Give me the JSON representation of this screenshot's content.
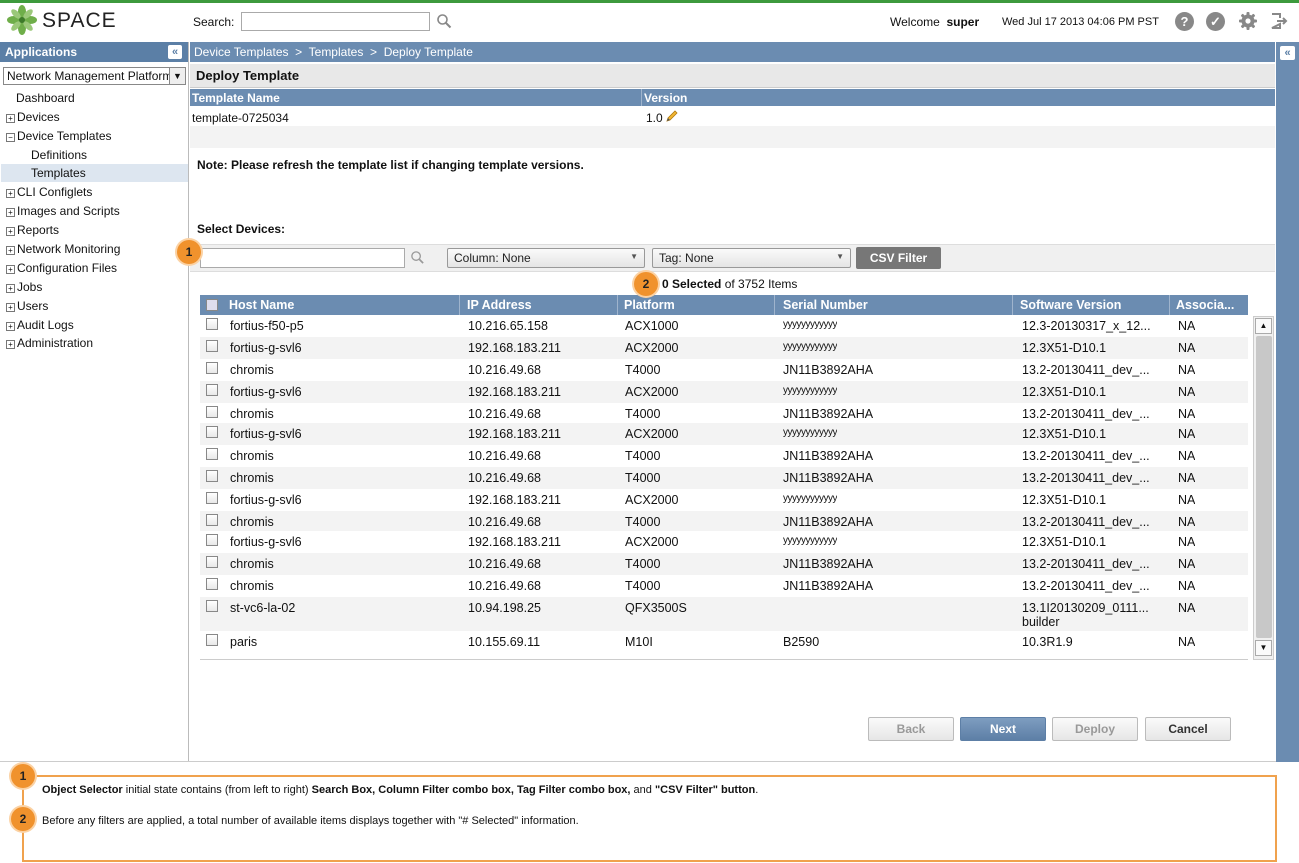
{
  "app": {
    "logo_text": "SPACE"
  },
  "header": {
    "search_label": "Search:",
    "search_value": "",
    "welcome_prefix": "Welcome",
    "username": "super",
    "datetime": "Wed Jul 17 2013 04:06 PM PST",
    "icons": [
      "help-icon",
      "tasks-icon",
      "settings-icon",
      "logout-icon"
    ]
  },
  "sidebar": {
    "title": "Applications",
    "app_selected": "Network Management Platform",
    "items": [
      {
        "label": "Dashboard",
        "expandable": false,
        "indent": 0
      },
      {
        "label": "Devices",
        "expandable": true,
        "expanded": false,
        "indent": 0
      },
      {
        "label": "Device Templates",
        "expandable": true,
        "expanded": true,
        "indent": 0
      },
      {
        "label": "Definitions",
        "expandable": false,
        "indent": 1
      },
      {
        "label": "Templates",
        "expandable": false,
        "indent": 1,
        "selected": true
      },
      {
        "label": "CLI Configlets",
        "expandable": true,
        "expanded": false,
        "indent": 0
      },
      {
        "label": "Images and Scripts",
        "expandable": true,
        "expanded": false,
        "indent": 0
      },
      {
        "label": "Reports",
        "expandable": true,
        "expanded": false,
        "indent": 0
      },
      {
        "label": "Network Monitoring",
        "expandable": true,
        "expanded": false,
        "indent": 0
      },
      {
        "label": "Configuration Files",
        "expandable": true,
        "expanded": false,
        "indent": 0
      },
      {
        "label": "Jobs",
        "expandable": true,
        "expanded": false,
        "indent": 0
      },
      {
        "label": "Users",
        "expandable": true,
        "expanded": false,
        "indent": 0
      },
      {
        "label": "Audit Logs",
        "expandable": true,
        "expanded": false,
        "indent": 0
      },
      {
        "label": "Administration",
        "expandable": true,
        "expanded": false,
        "indent": 0
      }
    ]
  },
  "breadcrumb": [
    "Device Templates",
    "Templates",
    "Deploy Template"
  ],
  "breadcrumb_sep": ">",
  "page_title": "Deploy Template",
  "template_table": {
    "headers": [
      "Template Name",
      "Version"
    ],
    "row": {
      "name": "template-0725034",
      "version": "1.0"
    }
  },
  "note": "Note: Please refresh the template list if changing template versions.",
  "select_devices_label": "Select Devices:",
  "filters": {
    "search_value": "",
    "column_label": "Column:",
    "column_value": "None",
    "tag_label": "Tag:",
    "tag_value": "None",
    "csv_button": "CSV Filter"
  },
  "selection": {
    "selected_text": "0 Selected",
    "of_text": "of 3752 Items"
  },
  "grid": {
    "headers": [
      "Host Name",
      "IP Address",
      "Platform",
      "Serial Number",
      "Software Version",
      "Associa..."
    ],
    "rows": [
      {
        "host": "fortius-f50-p5",
        "ip": "10.216.65.158",
        "platform": "ACX1000",
        "serial": "yyyyyyyyyyyy",
        "sw": "12.3-20130317_x_12...",
        "assoc": "NA"
      },
      {
        "host": "fortius-g-svl6",
        "ip": "192.168.183.211",
        "platform": "ACX2000",
        "serial": "yyyyyyyyyyyy",
        "sw": "12.3X51-D10.1",
        "assoc": "NA"
      },
      {
        "host": "chromis",
        "ip": "10.216.49.68",
        "platform": "T4000",
        "serial": "JN11B3892AHA",
        "sw": "13.2-20130411_dev_...",
        "assoc": "NA"
      },
      {
        "host": "fortius-g-svl6",
        "ip": "192.168.183.211",
        "platform": "ACX2000",
        "serial": "yyyyyyyyyyyy",
        "sw": "12.3X51-D10.1",
        "assoc": "NA"
      },
      {
        "host": "chromis",
        "ip": "10.216.49.68",
        "platform": "T4000",
        "serial": "JN11B3892AHA",
        "sw": "13.2-20130411_dev_...",
        "assoc": "NA"
      },
      {
        "host": "fortius-g-svl6",
        "ip": "192.168.183.211",
        "platform": "ACX2000",
        "serial": "yyyyyyyyyyyy",
        "sw": "12.3X51-D10.1",
        "assoc": "NA"
      },
      {
        "host": "chromis",
        "ip": "10.216.49.68",
        "platform": "T4000",
        "serial": "JN11B3892AHA",
        "sw": "13.2-20130411_dev_...",
        "assoc": "NA"
      },
      {
        "host": "chromis",
        "ip": "10.216.49.68",
        "platform": "T4000",
        "serial": "JN11B3892AHA",
        "sw": "13.2-20130411_dev_...",
        "assoc": "NA"
      },
      {
        "host": "fortius-g-svl6",
        "ip": "192.168.183.211",
        "platform": "ACX2000",
        "serial": "yyyyyyyyyyyy",
        "sw": "12.3X51-D10.1",
        "assoc": "NA"
      },
      {
        "host": "chromis",
        "ip": "10.216.49.68",
        "platform": "T4000",
        "serial": "JN11B3892AHA",
        "sw": "13.2-20130411_dev_...",
        "assoc": "NA"
      },
      {
        "host": "fortius-g-svl6",
        "ip": "192.168.183.211",
        "platform": "ACX2000",
        "serial": "yyyyyyyyyyyy",
        "sw": "12.3X51-D10.1",
        "assoc": "NA"
      },
      {
        "host": "chromis",
        "ip": "10.216.49.68",
        "platform": "T4000",
        "serial": "JN11B3892AHA",
        "sw": "13.2-20130411_dev_...",
        "assoc": "NA"
      },
      {
        "host": "chromis",
        "ip": "10.216.49.68",
        "platform": "T4000",
        "serial": "JN11B3892AHA",
        "sw": "13.2-20130411_dev_...",
        "assoc": "NA"
      },
      {
        "host": "st-vc6-la-02",
        "ip": "10.94.198.25",
        "platform": "QFX3500S",
        "serial": "",
        "sw": "13.1I20130209_0111...",
        "sw2": "builder",
        "assoc": "NA"
      },
      {
        "host": "paris",
        "ip": "10.155.69.11",
        "platform": "M10I",
        "serial": "B2590",
        "sw": "10.3R1.9",
        "assoc": "NA"
      }
    ]
  },
  "buttons": {
    "back": "Back",
    "next": "Next",
    "deploy": "Deploy",
    "cancel": "Cancel"
  },
  "callouts": {
    "badge1": "1",
    "badge2": "2",
    "annotation1": [
      {
        "text": "Object Selector",
        "bold": true
      },
      {
        "text": " initial state contains (from left to right) ",
        "bold": false
      },
      {
        "text": "Search Box, Column Filter combo box, Tag Filter combo box,",
        "bold": true
      },
      {
        "text": " and ",
        "bold": false
      },
      {
        "text": "\"CSV Filter\" button",
        "bold": true
      },
      {
        "text": ".",
        "bold": false
      }
    ],
    "annotation2": "Before any filters are applied, a total number of available items displays together with \"# Selected\" information."
  },
  "colors": {
    "header_blue": "#6b8cb1",
    "accent_green": "#3d9a3d",
    "callout_orange": "#f0922d"
  }
}
